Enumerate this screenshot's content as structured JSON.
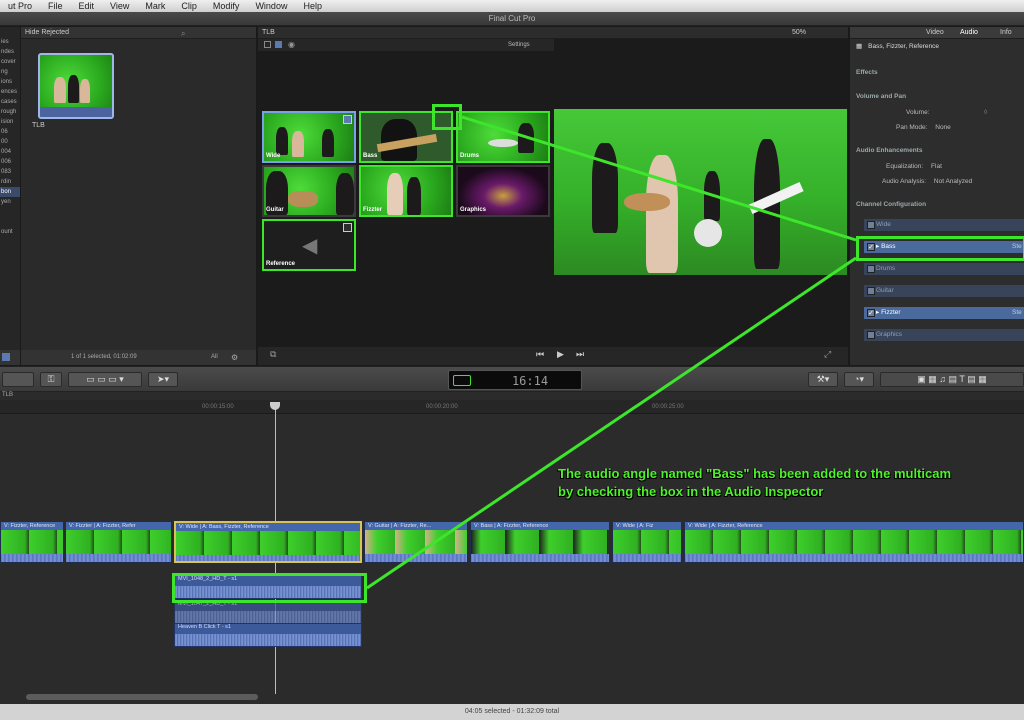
{
  "menubar": {
    "items": [
      "ut Pro",
      "File",
      "Edit",
      "View",
      "Mark",
      "Clip",
      "Modify",
      "Window",
      "Help"
    ]
  },
  "window_title": "Final Cut Pro",
  "sidebar": {
    "items": [
      "ies",
      "ndes",
      "cover",
      "ng",
      "ions",
      "ences",
      "cases",
      "rough",
      "ision",
      "06",
      "00",
      "004",
      "006",
      "083",
      "rdin",
      "bon",
      "yen",
      "",
      "",
      "ount"
    ]
  },
  "browser": {
    "header": "Hide Rejected",
    "clip_label": "TLB",
    "footer": "1 of 1 selected, 01:02:09",
    "zoom_label": "All"
  },
  "viewer": {
    "header": "TLB",
    "settings_label": "Settings",
    "zoom_label": "50%",
    "angles": [
      {
        "label": "Wide"
      },
      {
        "label": "Bass"
      },
      {
        "label": "Drums"
      },
      {
        "label": "Guitar"
      },
      {
        "label": "Fizzter"
      },
      {
        "label": "Graphics"
      },
      {
        "label": "Reference"
      }
    ]
  },
  "inspector": {
    "tabs": [
      "Video",
      "Audio",
      "Info"
    ],
    "clip_title": "Bass, Fizzter, Reference",
    "sections": {
      "effects": "Effects",
      "volume_pan": "Volume and Pan",
      "audio_enh": "Audio Enhancements",
      "channel_config": "Channel Configuration"
    },
    "volume_label": "Volume:",
    "pan_label": "Pan Mode:",
    "pan_value": "None",
    "eq_label": "Equalization:",
    "eq_value": "Flat",
    "analysis_label": "Audio Analysis:",
    "analysis_value": "Not Analyzed",
    "channels": [
      {
        "label": "Wide",
        "checked": false
      },
      {
        "label": "Bass",
        "checked": true
      },
      {
        "label": "Drums",
        "checked": false
      },
      {
        "label": "Guitar",
        "checked": false
      },
      {
        "label": "Fizzter",
        "checked": true
      },
      {
        "label": "Graphics",
        "checked": false
      }
    ],
    "stereo_label": "Ste"
  },
  "toolbar": {
    "timecode": "16:14"
  },
  "timeline": {
    "header": "TLB",
    "ruler_marks": [
      "00:00:15:00",
      "00:00:20:00",
      "00:00:25:00"
    ],
    "clips": [
      {
        "label": "V: Fizzter, Reference"
      },
      {
        "label": "V: Fizzter | A: Fizzter, Refer"
      },
      {
        "label": "V: Wide | A: Bass, Fizzter, Reference"
      },
      {
        "label": "V: Guitar | A: Fizzter, Re..."
      },
      {
        "label": "V: Bass | A: Fizzter, Reference"
      },
      {
        "label": "V: Wide | A: Fiz"
      },
      {
        "label": "V: Wide | A: Fizzter, Reference"
      }
    ],
    "audio_clips": [
      {
        "label": "MVI_1048_2_HD_T - s1"
      },
      {
        "label": "MVI_1047_2_HD_T - s1"
      },
      {
        "label": "Heaven B Click T - s1"
      }
    ]
  },
  "annotation": {
    "line1": "The audio angle named \"Bass\" has been added to the multicam",
    "line2": "by checking the box in the Audio Inspector"
  },
  "status": {
    "text": "04:05 selected - 01:32:09 total"
  },
  "colors": {
    "highlight": "#3ee62b",
    "selection": "#4a6a9e",
    "clip_blue": "#3a57a0"
  }
}
